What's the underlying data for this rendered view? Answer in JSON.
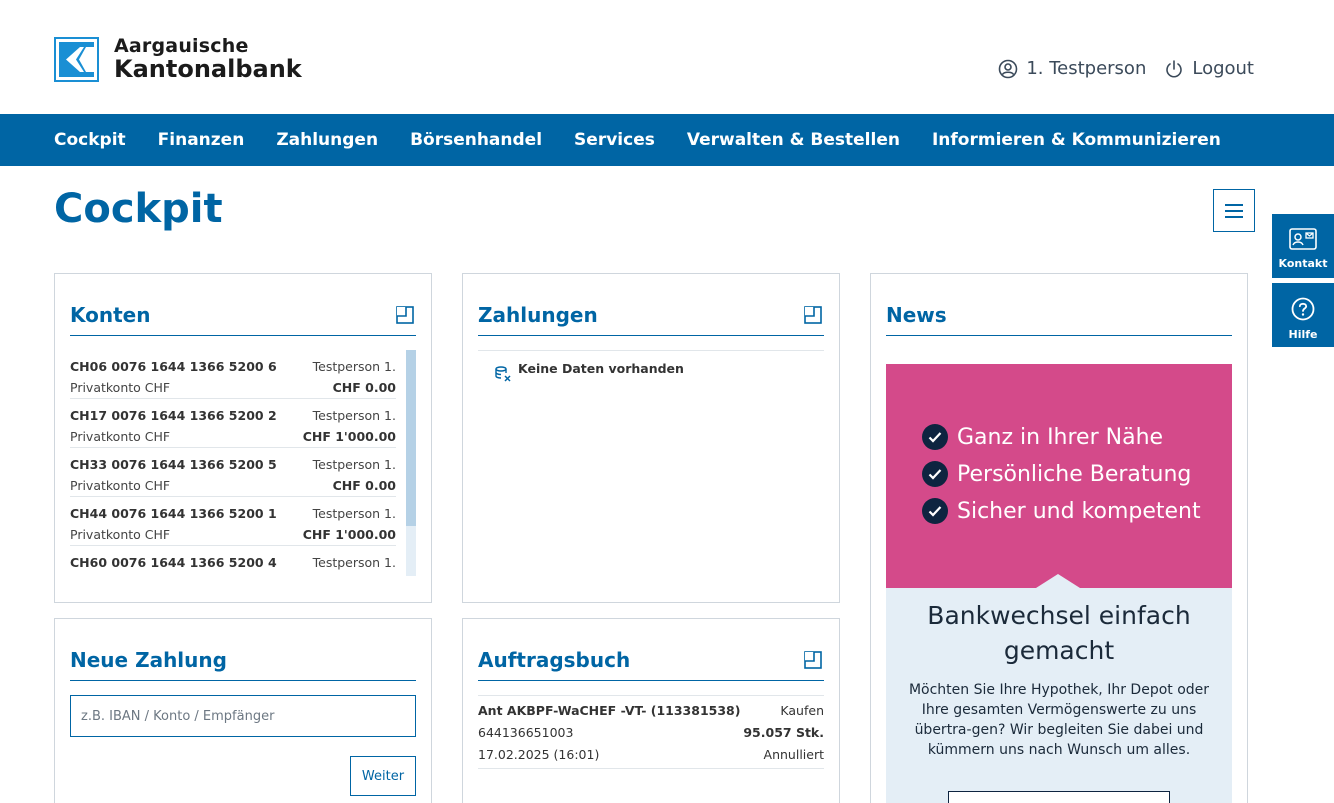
{
  "brand": {
    "name_line1": "Aargauische",
    "name_line2": "Kantonalbank",
    "accent": "#0065a4",
    "logo_color": "#1a8fd4"
  },
  "userbar": {
    "user_label": "1. Testperson",
    "user_icon": "user-circle-icon",
    "logout_label": "Logout",
    "logout_icon": "power-icon"
  },
  "nav": {
    "items": [
      {
        "label": "Cockpit"
      },
      {
        "label": "Finanzen"
      },
      {
        "label": "Zahlungen"
      },
      {
        "label": "Börsenhandel"
      },
      {
        "label": "Services"
      },
      {
        "label": "Verwalten & Bestellen"
      },
      {
        "label": "Informieren & Kommunizieren"
      }
    ]
  },
  "page": {
    "title": "Cockpit",
    "menu_icon": "hamburger-icon"
  },
  "side": {
    "kontakt_label": "Kontakt",
    "hilfe_label": "Hilfe"
  },
  "konten": {
    "title": "Konten",
    "accounts": [
      {
        "iban": "CH06 0076 1644 1366 5200 6",
        "owner": "Testperson 1.",
        "type": "Privatkonto CHF",
        "balance": "CHF 0.00"
      },
      {
        "iban": "CH17 0076 1644 1366 5200 2",
        "owner": "Testperson 1.",
        "type": "Privatkonto CHF",
        "balance": "CHF 1'000.00"
      },
      {
        "iban": "CH33 0076 1644 1366 5200 5",
        "owner": "Testperson 1.",
        "type": "Privatkonto CHF",
        "balance": "CHF 0.00"
      },
      {
        "iban": "CH44 0076 1644 1366 5200 1",
        "owner": "Testperson 1.",
        "type": "Privatkonto CHF",
        "balance": "CHF 1'000.00"
      },
      {
        "iban": "CH60 0076 1644 1366 5200 4",
        "owner": "Testperson 1.",
        "type": "",
        "balance": ""
      }
    ]
  },
  "zahlungen": {
    "title": "Zahlungen",
    "empty_text": "Keine Daten vorhanden"
  },
  "neue_zahlung": {
    "title": "Neue Zahlung",
    "input_placeholder": "z.B. IBAN / Konto / Empfänger",
    "input_value": "",
    "button_label": "Weiter"
  },
  "auftragsbuch": {
    "title": "Auftragsbuch",
    "order": {
      "name": "Ant AKBPF-WaCHEF -VT- (113381538)",
      "action": "Kaufen",
      "number": "644136651003",
      "quantity": "95.057 Stk.",
      "datetime": "17.02.2025 (16:01)",
      "status": "Annulliert"
    }
  },
  "news": {
    "title": "News",
    "benefits": [
      "Ganz in Ihrer Nähe",
      "Persönliche Beratung",
      "Sicher und kompetent"
    ],
    "headline": "Bankwechsel einfach gemacht",
    "body": "Möchten Sie Ihre Hypothek, Ihr Depot oder Ihre gesamten Vermögenswerte zu uns übertra-gen? Wir begleiten Sie dabei und kümmern uns nach Wunsch um alles.",
    "pink": "#d44a8a",
    "light": "#e4eef6"
  }
}
